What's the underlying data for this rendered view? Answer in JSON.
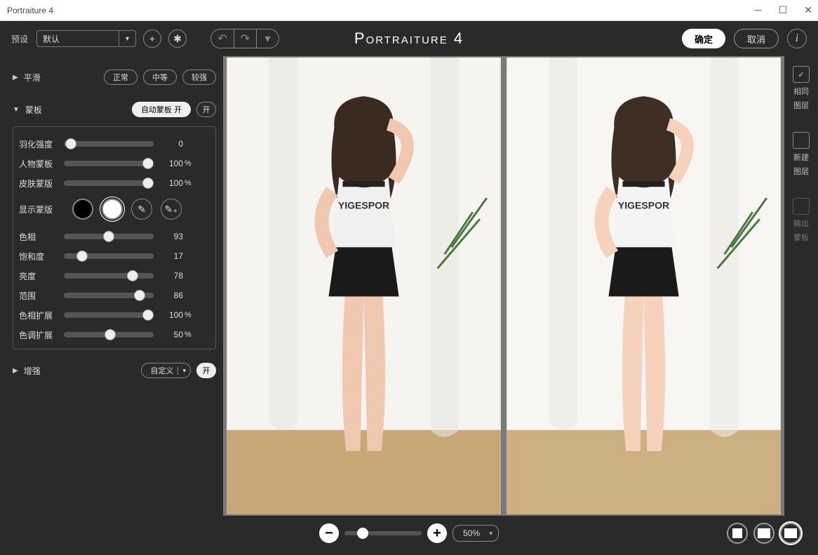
{
  "window": {
    "title": "Portraiture 4"
  },
  "toolbar": {
    "preset_label": "预设",
    "preset_value": "默认",
    "brand": "Portraiture 4",
    "ok": "确定",
    "cancel": "取消"
  },
  "smoothing": {
    "title": "平滑",
    "btn1": "正常",
    "btn2": "中等",
    "btn3": "较强"
  },
  "mask": {
    "title": "蒙板",
    "auto_label": "自动蒙板 开",
    "on": "开",
    "rows": {
      "feather": {
        "label": "羽化强度",
        "val": "0",
        "pct": "",
        "pos": 5
      },
      "person": {
        "label": "人物蒙板",
        "val": "100",
        "pct": "%",
        "pos": 92
      },
      "skin": {
        "label": "皮肤蒙版",
        "val": "100",
        "pct": "%",
        "pos": 92
      },
      "show": {
        "label": "显示蒙版"
      },
      "hue": {
        "label": "色相",
        "val": "93",
        "pct": "",
        "pos": 47
      },
      "sat": {
        "label": "饱和度",
        "val": "17",
        "pct": "",
        "pos": 17
      },
      "lit": {
        "label": "亮度",
        "val": "78",
        "pct": "",
        "pos": 73
      },
      "range": {
        "label": "范围",
        "val": "86",
        "pct": "",
        "pos": 80
      },
      "hueext": {
        "label": "色相扩展",
        "val": "100",
        "pct": "%",
        "pos": 92
      },
      "toneext": {
        "label": "色调扩展",
        "val": "50",
        "pct": "%",
        "pos": 48
      }
    }
  },
  "enhance": {
    "title": "增强",
    "custom": "自定义",
    "on": "开"
  },
  "rail": {
    "same1": "相同",
    "same2": "图层",
    "new1": "新建",
    "new2": "图层",
    "out1": "输出",
    "out2": "蒙板"
  },
  "zoom": {
    "value": "50%"
  }
}
